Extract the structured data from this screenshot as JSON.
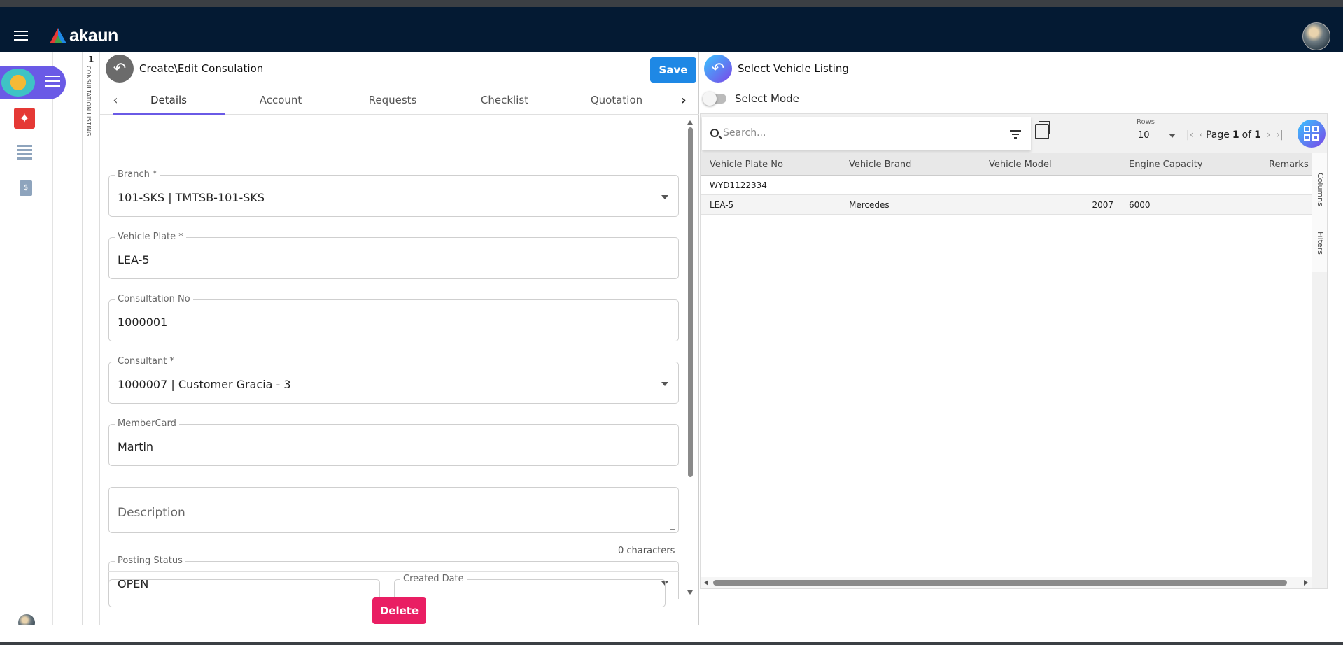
{
  "app": {
    "brand": "akaun",
    "colors": {
      "appbar": "#041a33",
      "accent": "#6a5ae6",
      "save": "#1e88e5",
      "delete": "#e91e63"
    }
  },
  "nav": {
    "icons": [
      "menu-icon",
      "pdf-icon",
      "list-icon",
      "document-icon"
    ]
  },
  "vertical_tab": {
    "number": "1",
    "label": "CONSULTATION LISTING"
  },
  "left_panel": {
    "title": "Create\\Edit Consulation",
    "save_label": "Save",
    "tabs": [
      "Details",
      "Account",
      "Requests",
      "Checklist",
      "Quotation"
    ],
    "active_tab": "Details",
    "fields": {
      "branch": {
        "label": "Branch *",
        "value": "101-SKS | TMTSB-101-SKS"
      },
      "vehicle_plate": {
        "label": "Vehicle Plate *",
        "value": "LEA-5"
      },
      "consultation_no": {
        "label": "Consultation No",
        "value": "1000001"
      },
      "consultant": {
        "label": "Consultant *",
        "value": "1000007 | Customer Gracia - 3"
      },
      "membercard": {
        "label": "MemberCard",
        "value": "Martin"
      },
      "description": {
        "placeholder": "Description",
        "char_count": "0 characters"
      },
      "posting_status": {
        "label": "Posting Status",
        "value": "OPEN"
      },
      "created_date": {
        "label": "Created Date"
      }
    },
    "delete_label": "Delete"
  },
  "right_panel": {
    "title": "Select Vehicle Listing",
    "select_mode_label": "Select Mode",
    "search_placeholder": "Search...",
    "rows_label": "Rows",
    "rows_value": "10",
    "pager": {
      "page_word": "Page",
      "page": "1",
      "of_word": "of",
      "total": "1"
    },
    "side_tabs": [
      "Columns",
      "Filters"
    ],
    "columns": [
      "Vehicle Plate No",
      "Vehicle Brand",
      "Vehicle Model",
      "Engine Capacity",
      "Remarks"
    ],
    "rows": [
      {
        "plate": "WYD1122334",
        "brand": "",
        "model": "",
        "engine": "",
        "remarks": ""
      },
      {
        "plate": "LEA-5",
        "brand": "Mercedes",
        "model": "2007",
        "engine": "6000",
        "remarks": ""
      }
    ]
  }
}
